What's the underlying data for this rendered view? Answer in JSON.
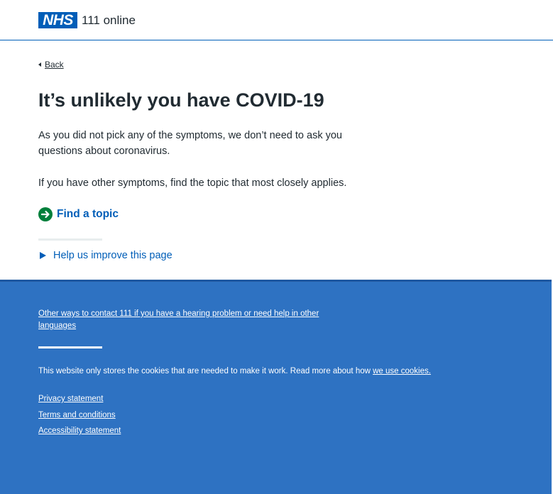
{
  "header": {
    "logo_text": "NHS",
    "service_name": "111 online"
  },
  "main": {
    "back_label": "Back",
    "title": "It’s unlikely you have COVID-19",
    "paragraph_1": "As you did not pick any of the symptoms, we don’t need to ask you questions about coronavirus.",
    "paragraph_2": "If you have other symptoms, find the topic that most closely applies.",
    "find_topic_label": "Find a topic",
    "help_improve_label": "Help us improve this page"
  },
  "footer": {
    "contact_link": "Other ways to contact 111 if you have a hearing problem or need help in other languages",
    "cookie_text": "This website only stores the cookies that are needed to make it work. Read more about how ",
    "cookie_link": "we use cookies.",
    "links": [
      "Privacy statement",
      "Terms and conditions",
      "Accessibility statement"
    ]
  },
  "colors": {
    "nhs_blue": "#005eb8",
    "footer_blue": "#2e72c2",
    "green": "#007f3b",
    "text": "#212b32"
  }
}
